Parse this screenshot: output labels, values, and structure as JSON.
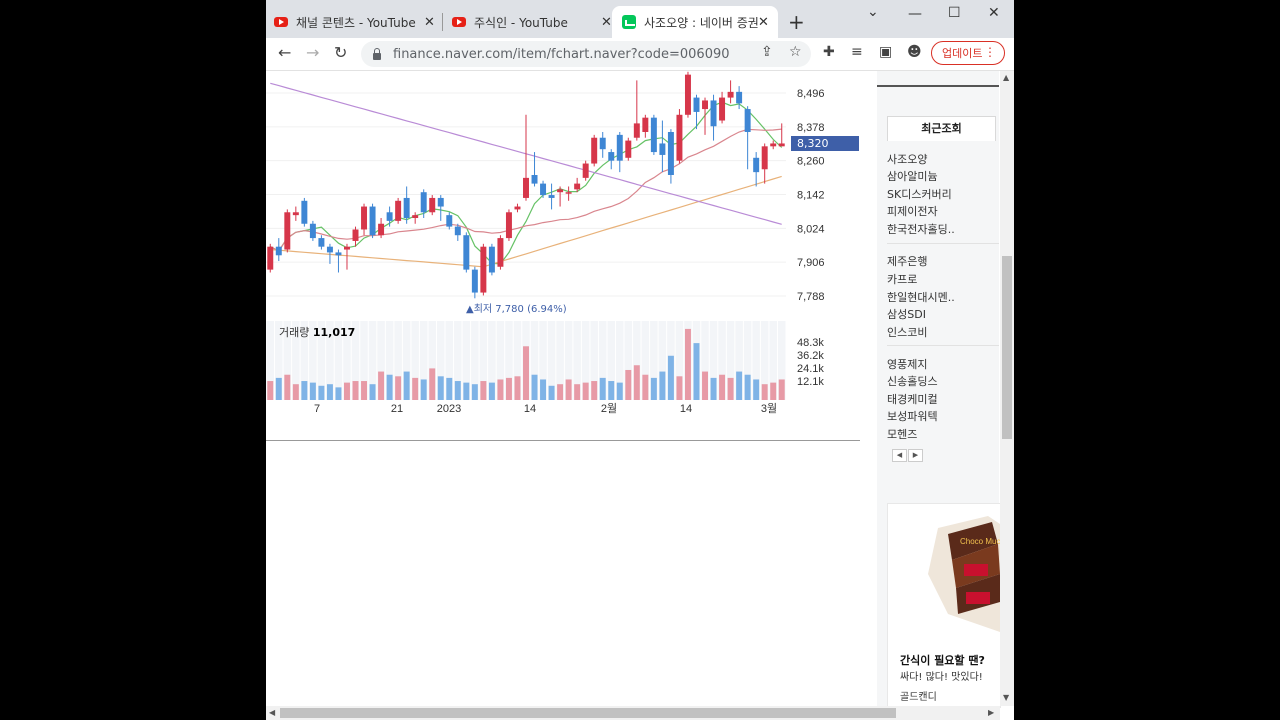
{
  "tabs": [
    {
      "title": "채널 콘텐츠 - YouTube",
      "icon": "youtube-icon"
    },
    {
      "title": "주식인 - YouTube",
      "icon": "youtube-icon"
    },
    {
      "title": "사조오양 : 네이버 증권",
      "icon": "naver-finance-icon",
      "active": true
    }
  ],
  "toolbar": {
    "url": "finance.naver.com/item/fchart.naver?code=006090",
    "update_label": "업데이트"
  },
  "chart": {
    "price_badge": "8,320",
    "low_label": "▲최저 7,780 (6.94%)",
    "volume_label_prefix": "거래량",
    "volume_value": "11,017"
  },
  "chart_data": {
    "type": "candlestick",
    "y_ticks": [
      "8,496",
      "8,378",
      "8,260",
      "8,142",
      "8,024",
      "7,906",
      "7,788"
    ],
    "y_tick_values": [
      8496,
      8378,
      8260,
      8142,
      8024,
      7906,
      7788
    ],
    "x_ticks": [
      "7",
      "21",
      "2023",
      "14",
      "2월",
      "14",
      "3월"
    ],
    "volume_ticks": [
      "48.3k",
      "36.2k",
      "24.1k",
      "12.1k"
    ],
    "current_price": 8320,
    "period_low": 7780,
    "candles": [
      {
        "o": 7880,
        "c": 7960,
        "h": 7970,
        "l": 7870,
        "up": true
      },
      {
        "o": 7960,
        "c": 7930,
        "h": 7990,
        "l": 7910,
        "up": false
      },
      {
        "o": 7950,
        "c": 8080,
        "h": 8090,
        "l": 7940,
        "up": true
      },
      {
        "o": 8080,
        "c": 8070,
        "h": 8100,
        "l": 8050,
        "up": true
      },
      {
        "o": 8120,
        "c": 8040,
        "h": 8130,
        "l": 8030,
        "up": false
      },
      {
        "o": 8040,
        "c": 7990,
        "h": 8050,
        "l": 7980,
        "up": false
      },
      {
        "o": 7990,
        "c": 7960,
        "h": 8000,
        "l": 7950,
        "up": false
      },
      {
        "o": 7960,
        "c": 7940,
        "h": 7970,
        "l": 7900,
        "up": false
      },
      {
        "o": 7940,
        "c": 7930,
        "h": 7950,
        "l": 7870,
        "up": false
      },
      {
        "o": 7950,
        "c": 7960,
        "h": 7970,
        "l": 7880,
        "up": true
      },
      {
        "o": 7980,
        "c": 8020,
        "h": 8030,
        "l": 7960,
        "up": true
      },
      {
        "o": 8020,
        "c": 8100,
        "h": 8110,
        "l": 8000,
        "up": true
      },
      {
        "o": 8100,
        "c": 8000,
        "h": 8110,
        "l": 7990,
        "up": false
      },
      {
        "o": 8000,
        "c": 8040,
        "h": 8060,
        "l": 7990,
        "up": true
      },
      {
        "o": 8080,
        "c": 8050,
        "h": 8100,
        "l": 8030,
        "up": false
      },
      {
        "o": 8050,
        "c": 8120,
        "h": 8130,
        "l": 8040,
        "up": true
      },
      {
        "o": 8130,
        "c": 8060,
        "h": 8170,
        "l": 8040,
        "up": false
      },
      {
        "o": 8060,
        "c": 8070,
        "h": 8080,
        "l": 8040,
        "up": true
      },
      {
        "o": 8150,
        "c": 8080,
        "h": 8160,
        "l": 8060,
        "up": false
      },
      {
        "o": 8080,
        "c": 8130,
        "h": 8140,
        "l": 8070,
        "up": true
      },
      {
        "o": 8130,
        "c": 8100,
        "h": 8140,
        "l": 8050,
        "up": false
      },
      {
        "o": 8070,
        "c": 8030,
        "h": 8080,
        "l": 8020,
        "up": false
      },
      {
        "o": 8030,
        "c": 8000,
        "h": 8040,
        "l": 7980,
        "up": false
      },
      {
        "o": 8000,
        "c": 7880,
        "h": 8010,
        "l": 7870,
        "up": false
      },
      {
        "o": 7880,
        "c": 7800,
        "h": 7890,
        "l": 7780,
        "up": false
      },
      {
        "o": 7800,
        "c": 7960,
        "h": 7970,
        "l": 7790,
        "up": true
      },
      {
        "o": 7960,
        "c": 7870,
        "h": 7970,
        "l": 7860,
        "up": false
      },
      {
        "o": 7890,
        "c": 7990,
        "h": 8000,
        "l": 7880,
        "up": true
      },
      {
        "o": 7990,
        "c": 8080,
        "h": 8090,
        "l": 7980,
        "up": true
      },
      {
        "o": 8090,
        "c": 8100,
        "h": 8110,
        "l": 8080,
        "up": true
      },
      {
        "o": 8130,
        "c": 8200,
        "h": 8420,
        "l": 8120,
        "up": true
      },
      {
        "o": 8210,
        "c": 8180,
        "h": 8290,
        "l": 8170,
        "up": false
      },
      {
        "o": 8180,
        "c": 8140,
        "h": 8190,
        "l": 8130,
        "up": false
      },
      {
        "o": 8140,
        "c": 8130,
        "h": 8180,
        "l": 8090,
        "up": false
      },
      {
        "o": 8150,
        "c": 8160,
        "h": 8170,
        "l": 8100,
        "up": true
      },
      {
        "o": 8150,
        "c": 8150,
        "h": 8170,
        "l": 8120,
        "up": true
      },
      {
        "o": 8160,
        "c": 8180,
        "h": 8200,
        "l": 8150,
        "up": true
      },
      {
        "o": 8200,
        "c": 8250,
        "h": 8260,
        "l": 8190,
        "up": true
      },
      {
        "o": 8250,
        "c": 8340,
        "h": 8350,
        "l": 8240,
        "up": true
      },
      {
        "o": 8340,
        "c": 8300,
        "h": 8360,
        "l": 8270,
        "up": false
      },
      {
        "o": 8290,
        "c": 8260,
        "h": 8300,
        "l": 8230,
        "up": false
      },
      {
        "o": 8350,
        "c": 8260,
        "h": 8360,
        "l": 8220,
        "up": false
      },
      {
        "o": 8270,
        "c": 8330,
        "h": 8340,
        "l": 8260,
        "up": true
      },
      {
        "o": 8340,
        "c": 8390,
        "h": 8540,
        "l": 8330,
        "up": true
      },
      {
        "o": 8360,
        "c": 8410,
        "h": 8420,
        "l": 8340,
        "up": true
      },
      {
        "o": 8410,
        "c": 8290,
        "h": 8420,
        "l": 8280,
        "up": false
      },
      {
        "o": 8320,
        "c": 8280,
        "h": 8400,
        "l": 8220,
        "up": false
      },
      {
        "o": 8360,
        "c": 8210,
        "h": 8370,
        "l": 8180,
        "up": false
      },
      {
        "o": 8260,
        "c": 8420,
        "h": 8440,
        "l": 8250,
        "up": true
      },
      {
        "o": 8420,
        "c": 8560,
        "h": 8570,
        "l": 8410,
        "up": true
      },
      {
        "o": 8480,
        "c": 8430,
        "h": 8490,
        "l": 8370,
        "up": false
      },
      {
        "o": 8440,
        "c": 8470,
        "h": 8480,
        "l": 8350,
        "up": true
      },
      {
        "o": 8470,
        "c": 8380,
        "h": 8490,
        "l": 8330,
        "up": false
      },
      {
        "o": 8400,
        "c": 8480,
        "h": 8500,
        "l": 8390,
        "up": true
      },
      {
        "o": 8480,
        "c": 8500,
        "h": 8540,
        "l": 8460,
        "up": true
      },
      {
        "o": 8500,
        "c": 8460,
        "h": 8520,
        "l": 8440,
        "up": false
      },
      {
        "o": 8440,
        "c": 8360,
        "h": 8450,
        "l": 8230,
        "up": false
      },
      {
        "o": 8270,
        "c": 8220,
        "h": 8290,
        "l": 8170,
        "up": false
      },
      {
        "o": 8230,
        "c": 8310,
        "h": 8320,
        "l": 8180,
        "up": true
      },
      {
        "o": 8310,
        "c": 8320,
        "h": 8330,
        "l": 8300,
        "up": true
      },
      {
        "o": 8310,
        "c": 8320,
        "h": 8390,
        "l": 8310,
        "up": true
      }
    ],
    "volumes": [
      12,
      14,
      16,
      10,
      12,
      11,
      9,
      10,
      8,
      11,
      12,
      12,
      10,
      18,
      16,
      15,
      18,
      14,
      13,
      20,
      15,
      14,
      12,
      11,
      10,
      12,
      11,
      13,
      14,
      15,
      34,
      16,
      13,
      9,
      10,
      13,
      10,
      11,
      12,
      14,
      12,
      11,
      19,
      22,
      16,
      14,
      18,
      28,
      15,
      45,
      36,
      18,
      14,
      16,
      14,
      18,
      16,
      13,
      10,
      11,
      13
    ],
    "moving_averages": [
      {
        "name": "MA5",
        "color": "#66c266"
      },
      {
        "name": "MA20",
        "color": "#d9868e"
      },
      {
        "name": "MA60",
        "color": "#e8b27a"
      },
      {
        "name": "MA120",
        "color": "#b98bd6"
      }
    ]
  },
  "sidebar": {
    "tab_label": "최근조회",
    "group1": [
      "사조오양",
      "삼아알미늄",
      "SK디스커버리",
      "피제이전자",
      "한국전자홀딩.."
    ],
    "group2": [
      "제주은행",
      "카프로",
      "한일현대시멘..",
      "삼성SDI",
      "인스코비"
    ],
    "group3": [
      "영풍제지",
      "신송홀딩스",
      "태경케미컬",
      "보성파워텍",
      "모헨즈"
    ],
    "pager_prev": "◀",
    "pager_next": "▶"
  },
  "ad": {
    "title": "간식이 필요할 땐?",
    "subtitle": "싸다! 많다! 맛있다!",
    "brand": "골드캔디",
    "box_text": "Choco Mucho"
  },
  "colors": {
    "up": "#d6364a",
    "down": "#3e86d4",
    "badge": "#3e5fa8"
  }
}
